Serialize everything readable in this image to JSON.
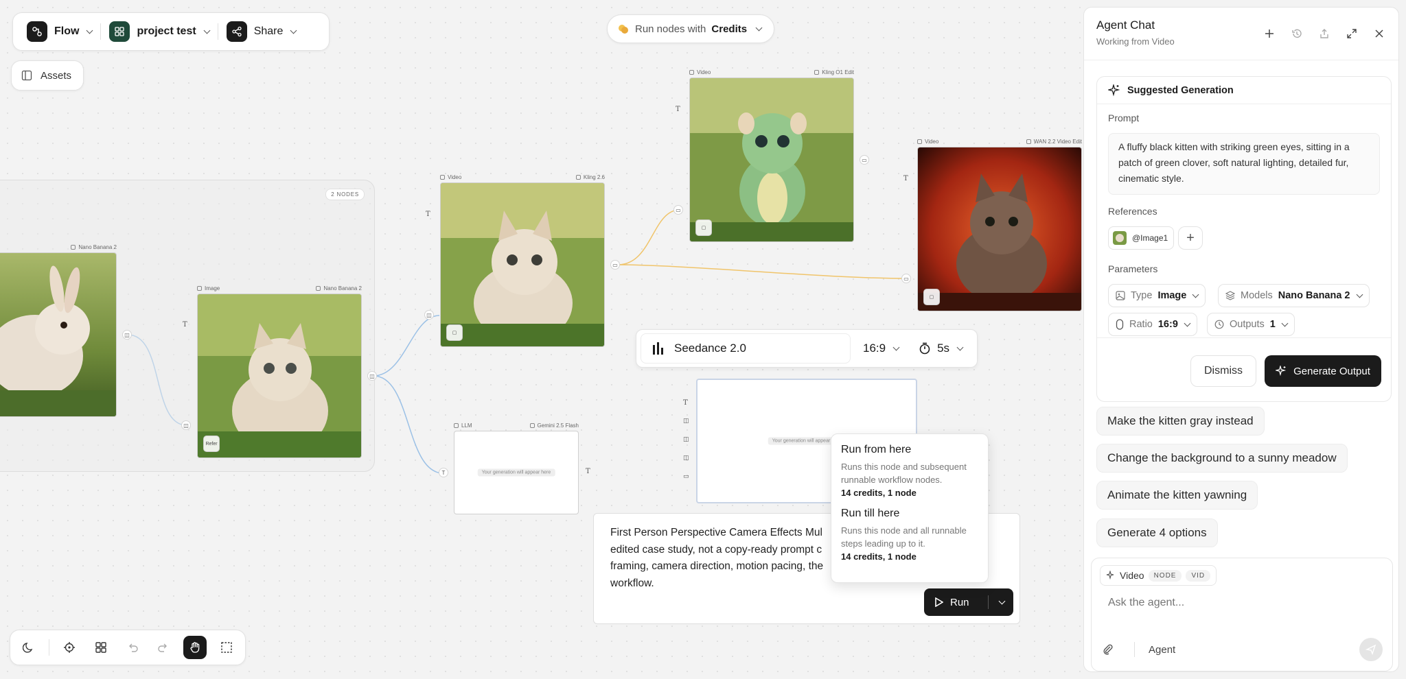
{
  "topbar": {
    "flow_label": "Flow",
    "project_label": "project test",
    "share_label": "Share"
  },
  "assets_label": "Assets",
  "run_credits": {
    "prefix": "Run nodes with",
    "value": "Credits"
  },
  "canvas": {
    "group_badge": "2 NODES",
    "nodes": {
      "rabbit": {
        "model": "Nano Banana 2"
      },
      "kitten_image": {
        "type": "Image",
        "model": "Nano Banana 2",
        "badge": "Refer"
      },
      "kitten_video": {
        "type": "Video",
        "model": "Kling 2.6"
      },
      "dragon_video": {
        "type": "Video",
        "model": "Kling O1 Edit"
      },
      "fire_video": {
        "type": "Video",
        "model": "WAN 2.2 Video Edit"
      },
      "llm": {
        "type": "LLM",
        "model": "Gemini 2.5 Flash",
        "placeholder": "Your generation will appear here"
      },
      "seedance": {
        "placeholder": "Your generation will appear here"
      }
    },
    "model_bar": {
      "model": "Seedance 2.0",
      "ratio": "16:9",
      "duration": "5s"
    },
    "text_node": {
      "line1": "First Person Perspective Camera Effects Mul",
      "line2": "edited case study, not a copy-ready prompt c",
      "line3": "framing, camera direction, motion pacing, the",
      "line4": "workflow."
    },
    "run_button": "Run",
    "run_menu": {
      "items": [
        {
          "title": "Run from here",
          "desc": "Runs this node and subsequent runnable workflow nodes.",
          "cost": "14 credits, 1 node"
        },
        {
          "title": "Run till here",
          "desc": "Runs this node and all runnable steps leading up to it.",
          "cost": "14 credits, 1 node"
        }
      ]
    }
  },
  "panel": {
    "title": "Agent Chat",
    "subtitle": "Working from Video",
    "card": {
      "heading": "Suggested Generation",
      "prompt_label": "Prompt",
      "prompt_text": "A fluffy black kitten with striking green eyes, sitting in a patch of green clover, soft natural lighting, detailed fur, cinematic style.",
      "references_label": "References",
      "reference_name": "@Image1",
      "parameters_label": "Parameters",
      "params": {
        "type_label": "Type",
        "type_value": "Image",
        "models_label": "Models",
        "models_value": "Nano Banana 2",
        "ratio_label": "Ratio",
        "ratio_value": "16:9",
        "outputs_label": "Outputs",
        "outputs_value": "1"
      },
      "dismiss": "Dismiss",
      "generate": "Generate Output"
    },
    "suggestions": [
      "Make the kitten gray instead",
      "Change the background to a sunny meadow",
      "Animate the kitten yawning",
      "Generate 4 options"
    ],
    "composer": {
      "context": "Video",
      "tag1": "NODE",
      "tag2": "VID",
      "placeholder": "Ask the agent...",
      "mode": "Agent"
    }
  },
  "colors": {
    "accent_dark": "#1b1b1b",
    "edge_blue": "#9cc1e6",
    "edge_orange": "#f0c46a"
  }
}
